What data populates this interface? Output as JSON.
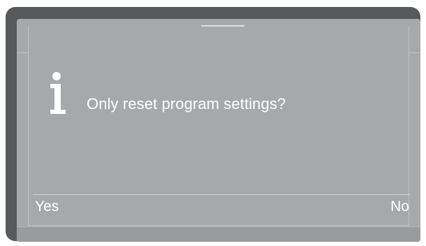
{
  "dialog": {
    "message": "Only reset program settings?",
    "icon": "info-icon"
  },
  "softkeys": {
    "left_label": "Yes",
    "right_label": "No"
  },
  "colors": {
    "bezel": "#58595b",
    "screen": "#a7a8aa",
    "text": "#ffffff"
  }
}
